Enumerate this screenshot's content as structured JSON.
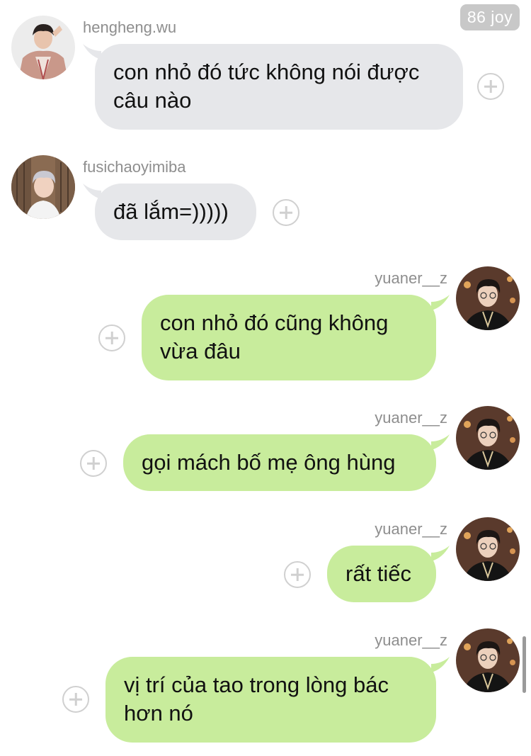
{
  "header": {
    "badge_label": "86 joy"
  },
  "messages": [
    {
      "sender": "hengheng.wu",
      "text": "con nhỏ đó tức không nói được câu nào",
      "direction": "incoming"
    },
    {
      "sender": "fusichaoyimiba",
      "text": "đã lắm=)))))",
      "direction": "incoming"
    },
    {
      "sender": "yuaner__z",
      "text": "con nhỏ đó cũng không vừa đâu",
      "direction": "outgoing"
    },
    {
      "sender": "yuaner__z",
      "text": "gọi mách bố mẹ ông hùng",
      "direction": "outgoing"
    },
    {
      "sender": "yuaner__z",
      "text": "rất tiếc",
      "direction": "outgoing"
    },
    {
      "sender": "yuaner__z",
      "text": "vị trí của tao trong lòng bác hơn nó",
      "direction": "outgoing"
    }
  ],
  "colors": {
    "incoming_bubble": "#e6e7ea",
    "outgoing_bubble": "#c8ec9c",
    "username_text": "#8e8e8e",
    "badge_bg": "#c8c8c8"
  },
  "icons": {
    "react": "plus-circle-icon"
  }
}
